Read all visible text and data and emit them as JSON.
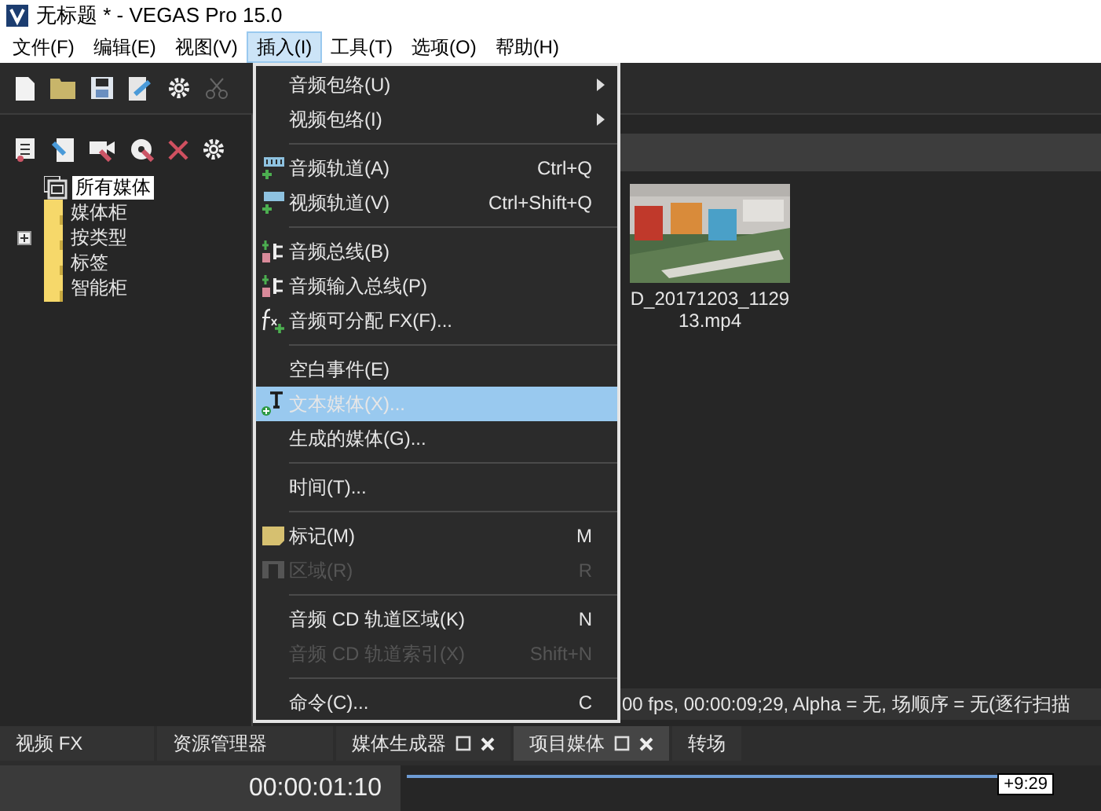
{
  "window": {
    "title": "无标题 * - VEGAS Pro 15.0"
  },
  "menubar": [
    {
      "label": "文件(F)",
      "selected": false
    },
    {
      "label": "编辑(E)",
      "selected": false
    },
    {
      "label": "视图(V)",
      "selected": false
    },
    {
      "label": "插入(I)",
      "selected": true
    },
    {
      "label": "工具(T)",
      "selected": false
    },
    {
      "label": "选项(O)",
      "selected": false
    },
    {
      "label": "帮助(H)",
      "selected": false
    }
  ],
  "tree": [
    {
      "label": "所有媒体",
      "selected": true,
      "children": [
        {
          "label": "媒体柜",
          "selected": false
        },
        {
          "label": "按类型",
          "selected": false,
          "expanded": false
        },
        {
          "label": "标签",
          "selected": false
        },
        {
          "label": "智能柜",
          "selected": false
        }
      ]
    }
  ],
  "media": [
    {
      "kind": "picture",
      "name_lines": [
        "D_20171203_1129",
        "13.mp4"
      ]
    }
  ],
  "status_text": "00 fps, 00:00:09;29, Alpha = 无, 场顺序 = 无(逐行扫描",
  "insert_menu": [
    {
      "kind": "item",
      "label": "音频包络(U)",
      "submenu": true,
      "disabled": false,
      "selected": false
    },
    {
      "kind": "item",
      "label": "视频包络(I)",
      "submenu": true,
      "disabled": false,
      "selected": false
    },
    {
      "kind": "separator"
    },
    {
      "kind": "item",
      "label": "音频轨道(A)",
      "shortcut": "Ctrl+Q",
      "submenu": false,
      "disabled": false,
      "selected": false
    },
    {
      "kind": "item",
      "label": "视频轨道(V)",
      "shortcut": "Ctrl+Shift+Q",
      "submenu": false,
      "disabled": false,
      "selected": false
    },
    {
      "kind": "separator"
    },
    {
      "kind": "item",
      "label": "音频总线(B)",
      "submenu": false,
      "disabled": false,
      "selected": false
    },
    {
      "kind": "item",
      "label": "音频输入总线(P)",
      "submenu": false,
      "disabled": false,
      "selected": false
    },
    {
      "kind": "item",
      "label": "音频可分配 FX(F)...",
      "submenu": false,
      "disabled": false,
      "selected": false
    },
    {
      "kind": "separator"
    },
    {
      "kind": "item",
      "label": "空白事件(E)",
      "submenu": false,
      "disabled": false,
      "selected": false
    },
    {
      "kind": "item",
      "label": "文本媒体(X)...",
      "submenu": false,
      "disabled": false,
      "selected": true
    },
    {
      "kind": "item",
      "label": "生成的媒体(G)...",
      "submenu": false,
      "disabled": false,
      "selected": false
    },
    {
      "kind": "separator"
    },
    {
      "kind": "item",
      "label": "时间(T)...",
      "submenu": false,
      "disabled": false,
      "selected": false
    },
    {
      "kind": "separator"
    },
    {
      "kind": "item",
      "label": "标记(M)",
      "shortcut": "M",
      "submenu": false,
      "disabled": false,
      "selected": false
    },
    {
      "kind": "item",
      "label": "区域(R)",
      "shortcut": "R",
      "submenu": false,
      "disabled": true,
      "selected": false
    },
    {
      "kind": "separator"
    },
    {
      "kind": "item",
      "label": "音频 CD 轨道区域(K)",
      "shortcut": "N",
      "submenu": false,
      "disabled": false,
      "selected": false
    },
    {
      "kind": "item",
      "label": "音频 CD 轨道索引(X)",
      "shortcut": "Shift+N",
      "submenu": false,
      "disabled": true,
      "selected": false
    },
    {
      "kind": "separator"
    },
    {
      "kind": "item",
      "label": "命令(C)...",
      "shortcut": "C",
      "submenu": false,
      "disabled": false,
      "selected": false
    }
  ],
  "dock_tabs": [
    {
      "label": "视频 FX",
      "selected": false,
      "closable": false
    },
    {
      "label": "资源管理器",
      "selected": false,
      "closable": false
    },
    {
      "label": "媒体生成器",
      "selected": false,
      "closable": true
    },
    {
      "label": "项目媒体",
      "selected": true,
      "closable": true
    },
    {
      "label": "转场",
      "selected": false,
      "closable": false
    }
  ],
  "timecode": "00:00:01:10",
  "timeline_marker": "+9:29"
}
